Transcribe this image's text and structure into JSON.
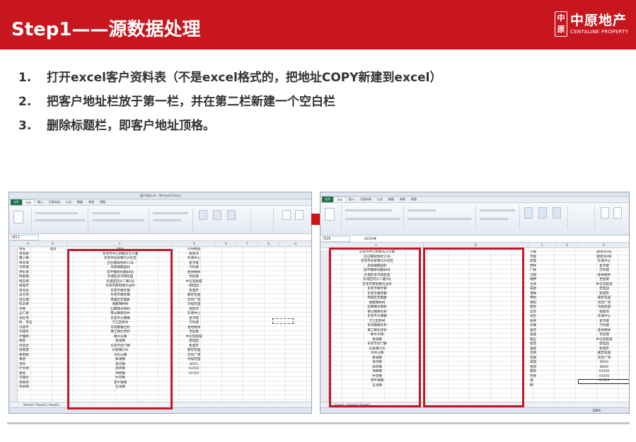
{
  "header": {
    "title": "Step1——源数据处理",
    "brand_color": "#c8161e",
    "logo_mark": "中原",
    "logo_cn": "中原地产",
    "logo_en": "CENTALINE PROPERTY"
  },
  "steps": [
    {
      "num": "1.",
      "text": "打开excel客户资料表（不是excel格式的，把地址COPY新建到excel）"
    },
    {
      "num": "2.",
      "text": "把客户地址栏放于第一栏，并在第二栏新建一个空白栏"
    },
    {
      "num": "3.",
      "text": "删除标题栏，即客户地址顶格。"
    }
  ],
  "left_screenshot": {
    "window_title": "客户资料.xls - Microsoft Excel",
    "tabs": [
      "文件",
      "开始",
      "插入",
      "页面布局",
      "公式",
      "数据",
      "审阅",
      "视图"
    ],
    "name_box": "B11",
    "columns": [
      "A",
      "B",
      "C",
      "D",
      "E",
      "F",
      "G",
      "H"
    ],
    "name_col": [
      "姓名",
      "曾思娟",
      "曹小微",
      "钟文琪",
      "刘琼瑞",
      "尹彩英",
      "韩金雄",
      "韩志明",
      "姜喜芳",
      "梁兆龙",
      "吴文英",
      "张玉瑞",
      "陈剑勇",
      "邓奇",
      "孟仁君",
      "宋红伟",
      "陈、李竞",
      "冯丽平",
      "刘旭军",
      "叶耀明",
      "黄宏",
      "何淑贞",
      "谢春慧",
      "黎昭辉",
      "黄君",
      "曾权",
      "叶文婷",
      "易柱",
      "刘瑞华",
      "张春荣",
      "何永明"
    ],
    "phone_header": "电话",
    "address_header": "地址",
    "addresses": [
      "东莞市中心桥路东方大厦",
      "东莞市长安镇乌沙社区",
      "企石镇旧围村11号",
      "凤岗镇雁田村",
      "常平镇新村路88号",
      "东城区星河城花园",
      "东城区同沙二路5号",
      "东莞市厚街镇大迳村",
      "东莞市寮步镇",
      "东莞市横沥镇",
      "南城区宏图路",
      "塘厦镇林村",
      "石碣镇水南村",
      "茶山镇南社村",
      "东莞市大朗镇",
      "万江区新村",
      "东坑镇角社村",
      "黄江镇北岸村",
      "樟木头镇",
      "清溪镇",
      "东莞市虎门镇",
      "长安镇沙头",
      "大岭山镇",
      "麻涌镇",
      "道滘镇",
      "高埗镇",
      "洪梅镇",
      "中堂镇",
      "望牛墩镇",
      "石龙镇"
    ],
    "taobao_header": "认购楼盘",
    "buildings": [
      "御景湾",
      "东城中心",
      "星河城",
      "万科城",
      "金地格林",
      "世纪城",
      "中信凯旋城",
      "碧桂园",
      "新城市",
      "嘉宏花园",
      "华凯广场",
      "鸿福花园",
      "御景湾",
      "东城中心",
      "星河城",
      "万科城",
      "金地格林",
      "世纪城",
      "中信凯旋城",
      "碧桂园",
      "新城市",
      "嘉宏花园",
      "华凯广场",
      "鸿福花园",
      "B503",
      "A1502",
      "A2103"
    ]
  },
  "right_screenshot": {
    "tabs": [
      "文件",
      "开始",
      "插入",
      "页面布局",
      "公式",
      "数据",
      "审阅",
      "视图"
    ],
    "name_box": "E26",
    "formula_value": "A150#",
    "columns": [
      "A",
      "B",
      "C",
      "D",
      "E"
    ],
    "addresses": [
      "东莞市中心桥路东方大厦",
      "企石镇旧围村11号",
      "东莞市长安镇乌沙社区",
      "凤岗镇雁田村",
      "常平镇新村路88号",
      "东城区星河城花园",
      "东城区同沙二路5号",
      "东莞市厚街镇大迳村",
      "东莞市寮步镇",
      "东莞市横沥镇",
      "南城区宏图路",
      "塘厦镇林村",
      "石碣镇水南村",
      "茶山镇南社村",
      "东莞市大朗镇",
      "万江区新村",
      "东坑镇角社村",
      "黄江镇北岸村",
      "樟木头镇",
      "清溪镇",
      "东莞市虎门镇",
      "长安镇沙头",
      "大岭山镇",
      "麻涌镇",
      "道滘镇",
      "高埗镇",
      "洪梅镇",
      "中堂镇",
      "望牛墩镇",
      "石龙镇"
    ],
    "names": [
      "小薇",
      "杰俊",
      "武俊",
      "梦林",
      "广林",
      "方超",
      "瑞伊",
      "文涛",
      "成进",
      "雪梅",
      "伊杭",
      "博凯",
      "胜欢",
      "志杰",
      "永生",
      "安林",
      "云峰",
      "金花",
      "金喜",
      "梅正",
      "苗宝",
      "金君",
      "灵熙",
      "佳丽",
      "美琪",
      "金荣",
      "晓莉",
      "月英",
      "进",
      "明"
    ],
    "buildings": [
      "御景湾1栋",
      "御景湾2栋",
      "东城中心",
      "星河城",
      "万科城",
      "金地格林",
      "世纪城",
      "中信凯旋城",
      "碧桂园",
      "新城市",
      "嘉宏花园",
      "华凯广场",
      "鸿福花园",
      "御景湾",
      "东城中心",
      "星河城",
      "万科城",
      "金地格林",
      "世纪城",
      "中信凯旋城",
      "碧桂园",
      "新城市",
      "嘉宏花园",
      "华凯广场",
      "B503",
      "B809",
      "A1502",
      "A1505",
      "A150#"
    ],
    "zoom": "100%"
  }
}
